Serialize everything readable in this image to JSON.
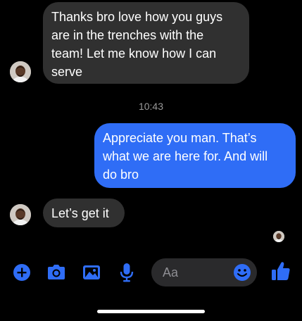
{
  "conversation": {
    "messages": [
      {
        "direction": "incoming",
        "lines": [
          "Thanks bro love how you guys",
          "are in the trenches with the",
          "team! Let me know how I can",
          "serve"
        ]
      },
      {
        "direction": "outgoing",
        "lines": [
          "Appreciate you man. That’s",
          "what we are here for. And will",
          "do bro"
        ]
      },
      {
        "direction": "incoming",
        "lines": [
          "Let’s get it"
        ]
      }
    ],
    "timestamp": "10:43"
  },
  "composer": {
    "placeholder": "Aa",
    "icons": [
      "plus-circle-icon",
      "camera-icon",
      "photo-icon",
      "microphone-icon",
      "emoji-icon",
      "thumbs-up-icon"
    ]
  },
  "colors": {
    "background": "#000000",
    "incoming_bubble": "#303030",
    "outgoing_bubble": "#2f6df6",
    "accent": "#2f6df6",
    "timestamp": "#9a9a9a",
    "input_field": "#2a2a2c"
  }
}
